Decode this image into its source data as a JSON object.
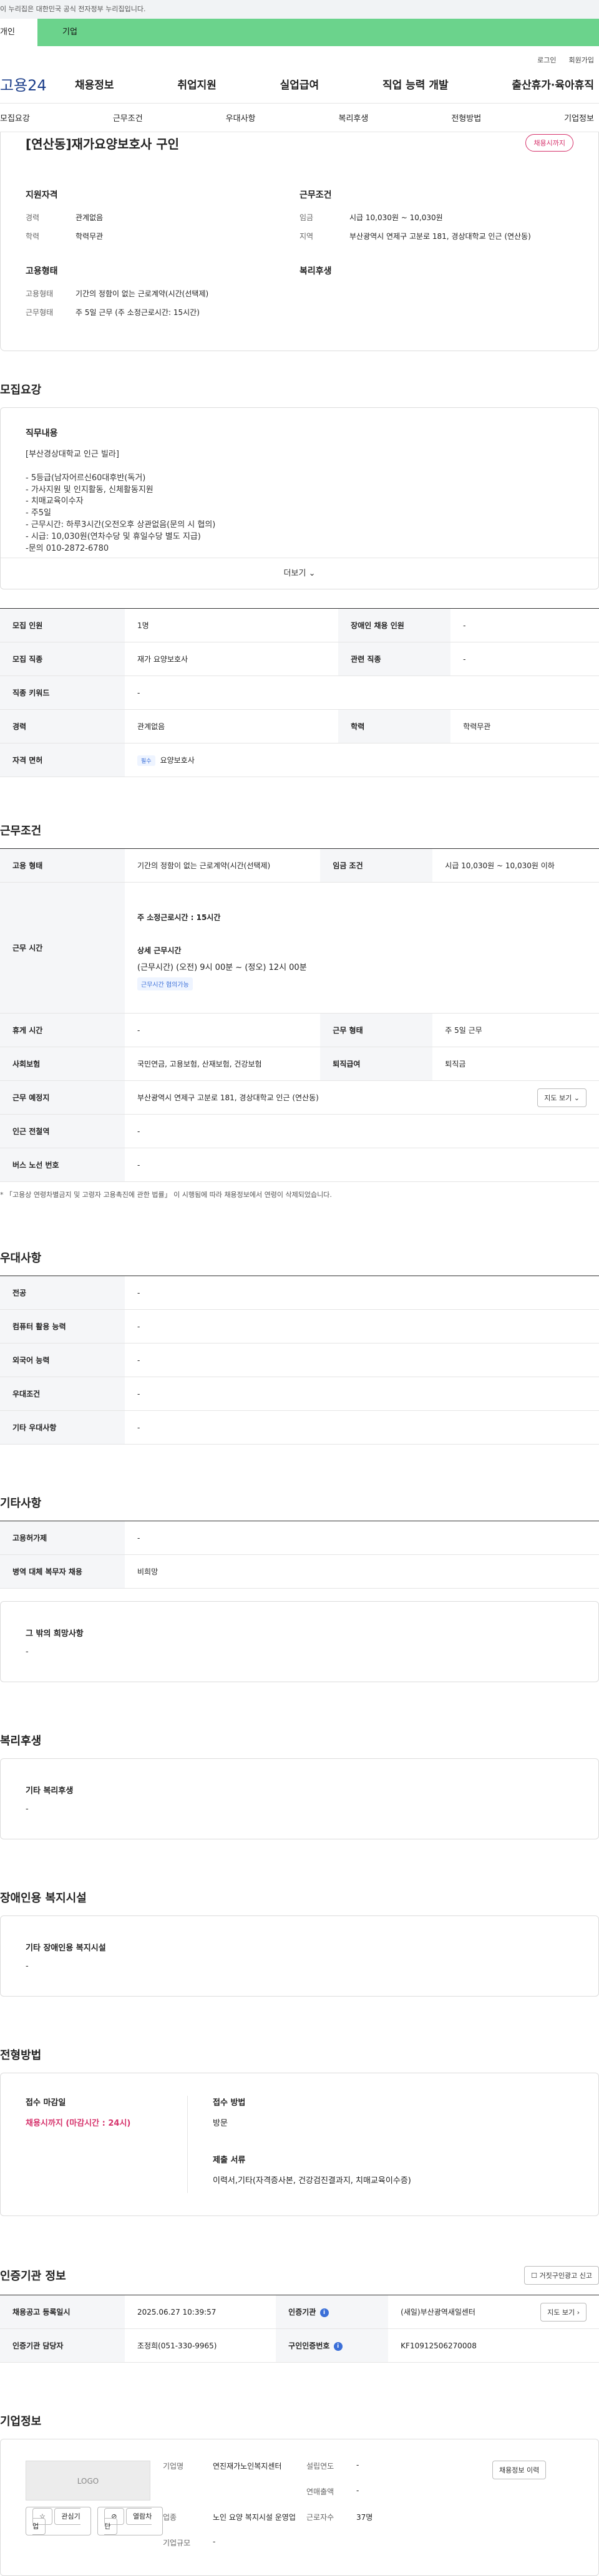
{
  "banner": {
    "text": "이 누리집은 대한민국 공식 전자정부 누리집입니다."
  },
  "tabs": {
    "personal": "개인",
    "company": "기업"
  },
  "util": {
    "login": "로그인",
    "signup": "회원가입"
  },
  "gnb": {
    "logo": "고용24",
    "menu": [
      "채용정보",
      "취업지원",
      "실업급여",
      "직업 능력 개발",
      "출산휴가·육아휴직"
    ]
  },
  "subnav": [
    "모집요강",
    "근무조건",
    "우대사항",
    "복리후생",
    "전형방법",
    "기업정보"
  ],
  "summary": {
    "title": "[연산동]재가요양보호사 구인",
    "status": "채용시까지",
    "qual_title": "지원자격",
    "career_k": "경력",
    "career_v": "관계없음",
    "edu_k": "학력",
    "edu_v": "학력무관",
    "cond_title": "근무조건",
    "wage_k": "임금",
    "wage_v": "시급 10,030원 ~ 10,030원",
    "region_k": "지역",
    "region_v": "부산광역시 연제구 고분로 181, 경상대학교 인근 (연산동)",
    "emp_title": "고용형태",
    "emptype_k": "고용형태",
    "emptype_v": "기간의 정함이 없는 근로계약(시간(선택제)",
    "worktype_k": "근무형태",
    "worktype_v": "주 5일 근무 (주 소정근로시간: 15시간)",
    "welfare_title": "복리후생"
  },
  "recruit": {
    "section": "모집요강",
    "duty_title": "직무내용",
    "duty_text": "[부산경상대학교 인근 빌라]\n\n- 5등급(남자어르신60대후반(독거)\n- 가사지원 및 인지활동, 신체활동지원\n- 치매교육이수자\n- 주5일\n- 근무시간: 하루3시간(오전오후 상관없음(문의 시 협의)\n- 시급: 10,030원(연차수당 및 휴일수당 별도 지급)\n-문의 010-2872-6780",
    "more": "더보기",
    "rows": [
      {
        "k1": "모집 인원",
        "v1": "1명",
        "k2": "장애인 채용 인원",
        "v2": "-"
      },
      {
        "k1": "모집 직종",
        "v1": "재가 요양보호사",
        "k2": "관련 직종",
        "v2": "-"
      },
      {
        "k1": "직종 키워드",
        "v1": "-"
      },
      {
        "k1": "경력",
        "v1": "관계없음",
        "k2": "학력",
        "v2": "학력무관"
      }
    ],
    "license_k": "자격 면허",
    "license_tag": "필수",
    "license_v": "요양보호사"
  },
  "work": {
    "section": "근무조건",
    "emp_k": "고용 형태",
    "emp_v": "기간의 정함이 없는 근로계약(시간(선택제)",
    "wage_k": "임금 조건",
    "wage_v": "시급 10,030원 ~ 10,030원 이하",
    "hours_k": "근무 시간",
    "hours_main": "주 소정근로시간 : 15시간",
    "hours_detail_title": "상세 근무시간",
    "hours_detail": "(근무시간) (오전) 9시 00분 ~ (정오) 12시 00분",
    "hours_tag": "근무시간 협의가능",
    "rest_k": "휴게 시간",
    "rest_v": "-",
    "form_k": "근무 형태",
    "form_v": "주 5일 근무",
    "ins_k": "사회보험",
    "ins_v": "국민연금, 고용보험, 산재보험, 건강보험",
    "sev_k": "퇴직급여",
    "sev_v": "퇴직금",
    "loc_k": "근무 예정지",
    "loc_v": "부산광역시 연제구 고분로 181, 경상대학교 인근 (연산동)",
    "map_btn": "지도 보기",
    "subway_k": "인근 전철역",
    "subway_v": "-",
    "bus_k": "버스 노선 번호",
    "bus_v": "-",
    "note": "* 「고용상 연령차별금지 및 고령자 고용촉진에 관한 법률」 이 시행됨에 따라 채용정보에서 연령이 삭제되었습니다."
  },
  "pref": {
    "section": "우대사항",
    "rows": [
      {
        "k": "전공",
        "v": "-"
      },
      {
        "k": "컴퓨터 활용 능력",
        "v": "-"
      },
      {
        "k": "외국어 능력",
        "v": "-"
      },
      {
        "k": "우대조건",
        "v": "-"
      },
      {
        "k": "기타 우대사항",
        "v": "-"
      }
    ]
  },
  "etc": {
    "section": "기타사항",
    "rows": [
      {
        "k": "고용허가제",
        "v": "-"
      },
      {
        "k": "병역 대체 복무자 채용",
        "v": "비희망"
      }
    ],
    "other_title": "그 밖의 희망사항",
    "other_v": "-"
  },
  "welfare": {
    "section": "복리후생",
    "title": "기타 복리후생",
    "v": "-"
  },
  "disabled": {
    "section": "장애인용 복지시설",
    "title": "기타 장애인용 복지시설",
    "v": "-"
  },
  "process": {
    "section": "전형방법",
    "deadline_title": "접수 마감일",
    "deadline_v": "채용시까지 (마감시간 : 24시)",
    "method_title": "접수 방법",
    "method_v": "방문",
    "docs_title": "제출 서류",
    "docs_v": "이력서,기타(자격증사본, 건강검진결과지, 치매교육이수증)"
  },
  "auth": {
    "section": "인증기관 정보",
    "report_btn": "거짓구인광고 신고",
    "reg_k": "채용공고 등록일시",
    "reg_v": "2025.06.27 10:39:57",
    "org_k": "인증기관",
    "org_v": "(새일)부산광역새일센터",
    "map_btn": "지도 보기",
    "mgr_k": "인증기관 담당자",
    "mgr_v": "조정희(051-330-9965)",
    "no_k": "구인인증번호",
    "no_v": "KF10912506270008"
  },
  "companyinfo": {
    "section": "기업정보",
    "logo": "LOGO",
    "fav": "관심기업",
    "block": "열람차단",
    "name_k": "기업명",
    "name_v": "연진재가노인복지센터",
    "est_k": "설립연도",
    "est_v": "-",
    "sales_k": "연매출액",
    "sales_v": "-",
    "ind_k": "업종",
    "ind_v": "노인 요양 복지시설 운영업",
    "emp_k": "근로자수",
    "emp_v": "37명",
    "size_k": "기업규모",
    "size_v": "-",
    "jobs_btn": "채용정보 이력"
  }
}
